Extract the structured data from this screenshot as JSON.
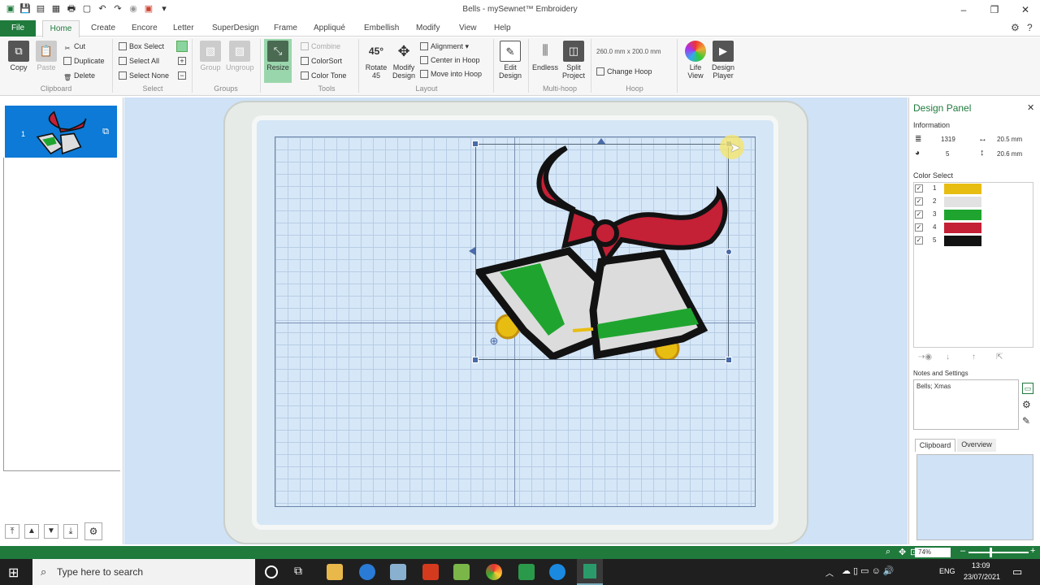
{
  "window": {
    "title": "Bells - mySewnet™ Embroidery",
    "minimize": "–",
    "restore": "❐",
    "close": "✕"
  },
  "quick_access": [
    "▣",
    "💾",
    "▤",
    "▦",
    "🖶",
    "▢",
    "↶",
    "↷",
    "◉",
    "▣",
    "▾"
  ],
  "menu": {
    "file": "File",
    "tabs": [
      "Home",
      "Create",
      "Encore",
      "Letter",
      "SuperDesign",
      "Frame",
      "Appliqué",
      "Embellish",
      "Modify",
      "View",
      "Help"
    ]
  },
  "ribbon": {
    "clipboard": {
      "copy": "Copy",
      "paste": "Paste",
      "cut": "Cut",
      "duplicate": "Duplicate",
      "delete": "Delete",
      "group": "Clipboard"
    },
    "select": {
      "box_select": "Box Select",
      "select_all": "Select All",
      "select_none": "Select None",
      "group": "Select"
    },
    "groups": {
      "group_btn": "Group",
      "ungroup": "Ungroup",
      "group": "Groups"
    },
    "tools": {
      "resize": "Resize",
      "combine": "Combine",
      "colorsort": "ColorSort",
      "color_tone": "Color Tone",
      "group": "Tools"
    },
    "layout": {
      "rotate_line1": "Rotate",
      "rotate_line2": "45",
      "modify_line1": "Modify",
      "modify_line2": "Design",
      "rotate_icon": "45°",
      "alignment": "Alignment",
      "center_hoop": "Center in Hoop",
      "move_hoop": "Move into Hoop",
      "group": "Layout"
    },
    "edit": {
      "line1": "Edit",
      "line2": "Design"
    },
    "multihoop": {
      "endless": "Endless",
      "split_line1": "Split",
      "split_line2": "Project",
      "group": "Multi-hoop"
    },
    "hoop": {
      "size": "260.0 mm x 200.0 mm",
      "change": "Change Hoop",
      "group": "Hoop"
    },
    "life_view": {
      "line1": "Life",
      "line2": "View"
    },
    "design_player": {
      "line1": "Design",
      "line2": "Player"
    }
  },
  "left_panel": {
    "item_number": "1"
  },
  "design_panel": {
    "title": "Design Panel",
    "information_label": "Information",
    "stitches": "1319",
    "width": "20.5 mm",
    "colors": "5",
    "height": "20.6 mm",
    "color_select_label": "Color Select",
    "colors_list": [
      {
        "n": "1",
        "hex": "#e8bd12"
      },
      {
        "n": "2",
        "hex": "#e2e2e2"
      },
      {
        "n": "3",
        "hex": "#1fa52f"
      },
      {
        "n": "4",
        "hex": "#c42036"
      },
      {
        "n": "5",
        "hex": "#121212"
      }
    ],
    "notes_label": "Notes and Settings",
    "notes_text": "Bells; Xmas",
    "tab_clipboard": "Clipboard",
    "tab_overview": "Overview"
  },
  "status": {
    "zoom": "74%"
  },
  "taskbar": {
    "search_placeholder": "Type here to search",
    "lang": "ENG",
    "time": "13:09",
    "date": "23/07/2021"
  }
}
